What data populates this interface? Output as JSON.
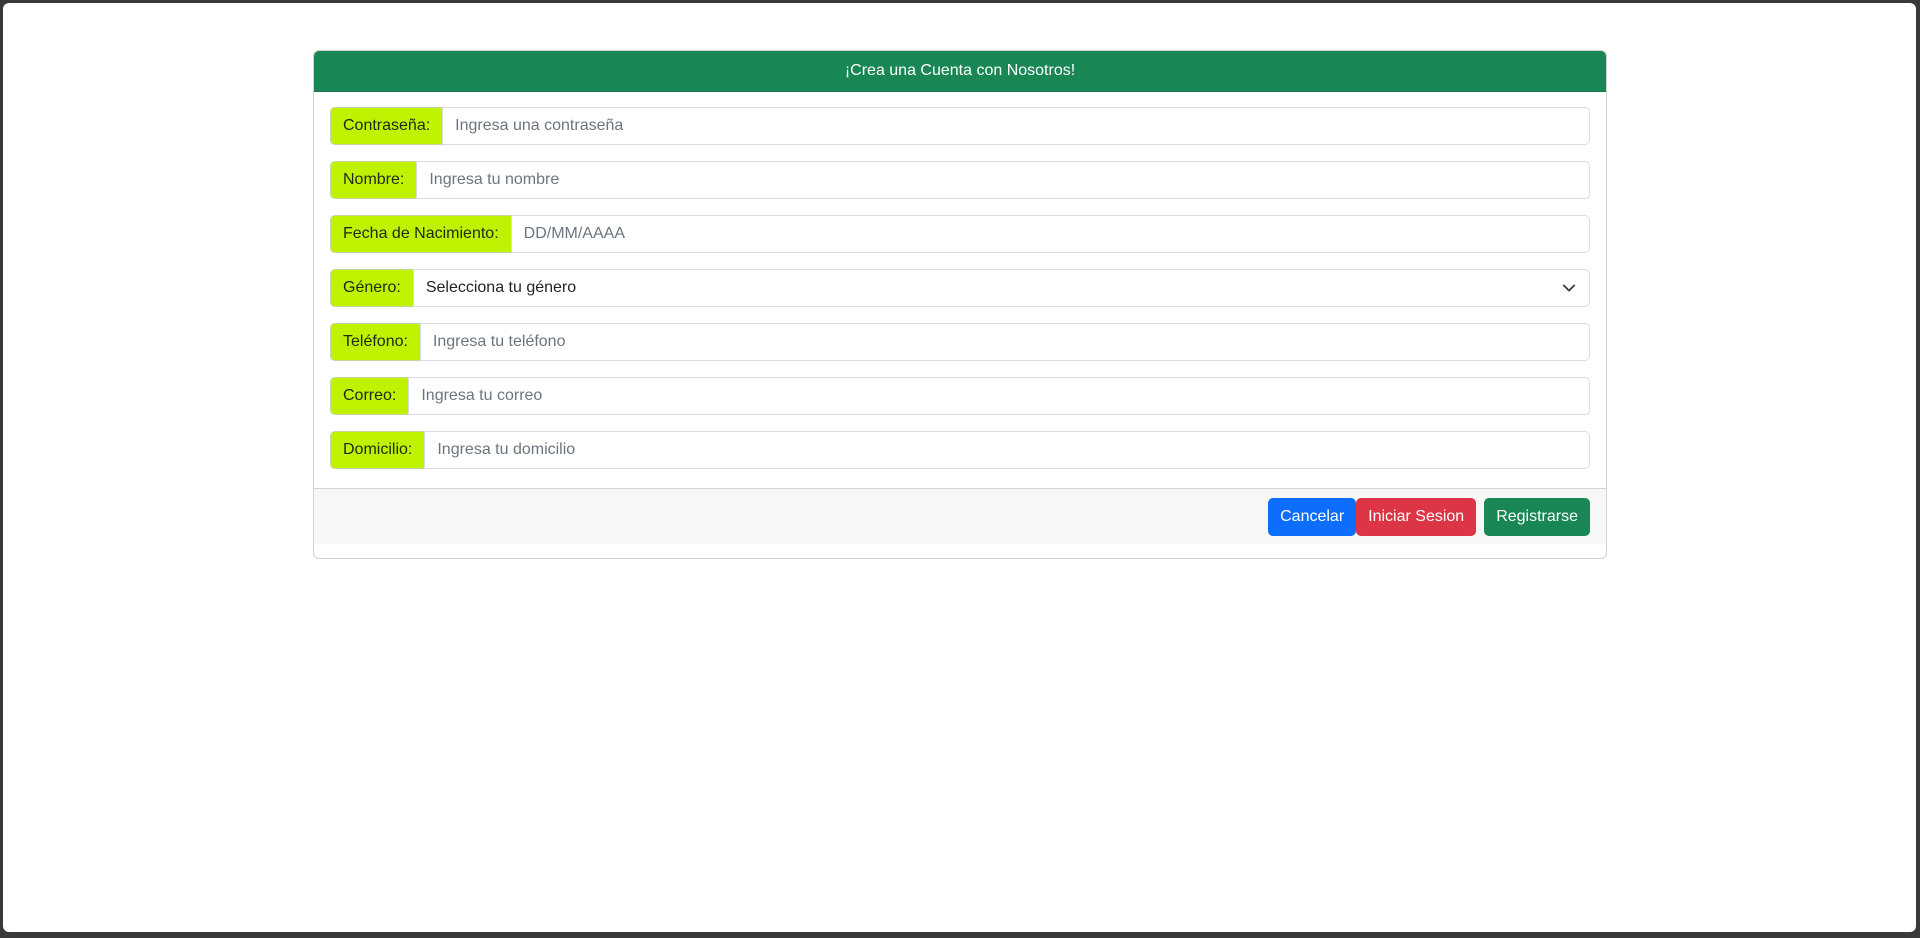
{
  "card": {
    "title": "¡Crea una Cuenta con Nosotros!"
  },
  "form": {
    "fields": [
      {
        "label": "Contraseña:",
        "placeholder": "Ingresa una contraseña",
        "value": ""
      },
      {
        "label": "Nombre:",
        "placeholder": "Ingresa tu nombre",
        "value": ""
      },
      {
        "label": "Fecha de Nacimiento:",
        "placeholder": "DD/MM/AAAA",
        "value": ""
      },
      {
        "label": "Género:",
        "selected": "Selecciona tu género",
        "icon": "chevron-down-icon"
      },
      {
        "label": "Teléfono:",
        "placeholder": "Ingresa tu teléfono",
        "value": ""
      },
      {
        "label": "Correo:",
        "placeholder": "Ingresa tu correo",
        "value": ""
      },
      {
        "label": "Domicilio:",
        "placeholder": "Ingresa tu domicilio",
        "value": ""
      }
    ]
  },
  "footer": {
    "cancel_label": "Cancelar",
    "login_label": "Iniciar Sesion",
    "register_label": "Registrarse"
  },
  "colors": {
    "header_bg": "#198754",
    "label_bg": "#bef200",
    "cancel_bg": "#0d6efd",
    "login_bg": "#dc3545",
    "register_bg": "#198754"
  }
}
